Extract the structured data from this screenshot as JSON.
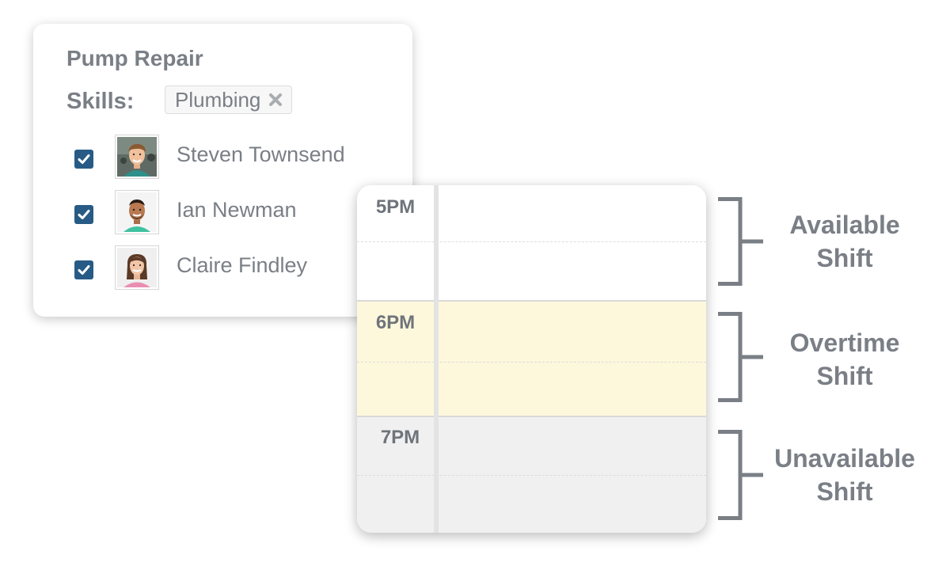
{
  "job": {
    "title": "Pump Repair",
    "skills_label": "Skills:",
    "skill_tags": [
      {
        "label": "Plumbing",
        "remove_icon": "times-icon"
      }
    ],
    "assignees": [
      {
        "name": "Steven Townsend",
        "checked": true
      },
      {
        "name": "Ian Newman",
        "checked": true
      },
      {
        "name": "Claire Findley",
        "checked": true
      }
    ]
  },
  "schedule": {
    "rows": [
      {
        "time": "5PM",
        "state": "available"
      },
      {
        "time": "6PM",
        "state": "overtime"
      },
      {
        "time": "7PM",
        "state": "unavailable"
      }
    ]
  },
  "legend": [
    {
      "line1": "Available",
      "line2": "Shift"
    },
    {
      "line1": "Overtime",
      "line2": "Shift"
    },
    {
      "line1": "Unavailable",
      "line2": "Shift"
    }
  ],
  "colors": {
    "text": "#7a7f86",
    "checkbox": "#275b85",
    "available": "#ffffff",
    "overtime": "#fdf8dc",
    "unavailable": "#f0f0f0",
    "bracket": "#7a7f86"
  }
}
